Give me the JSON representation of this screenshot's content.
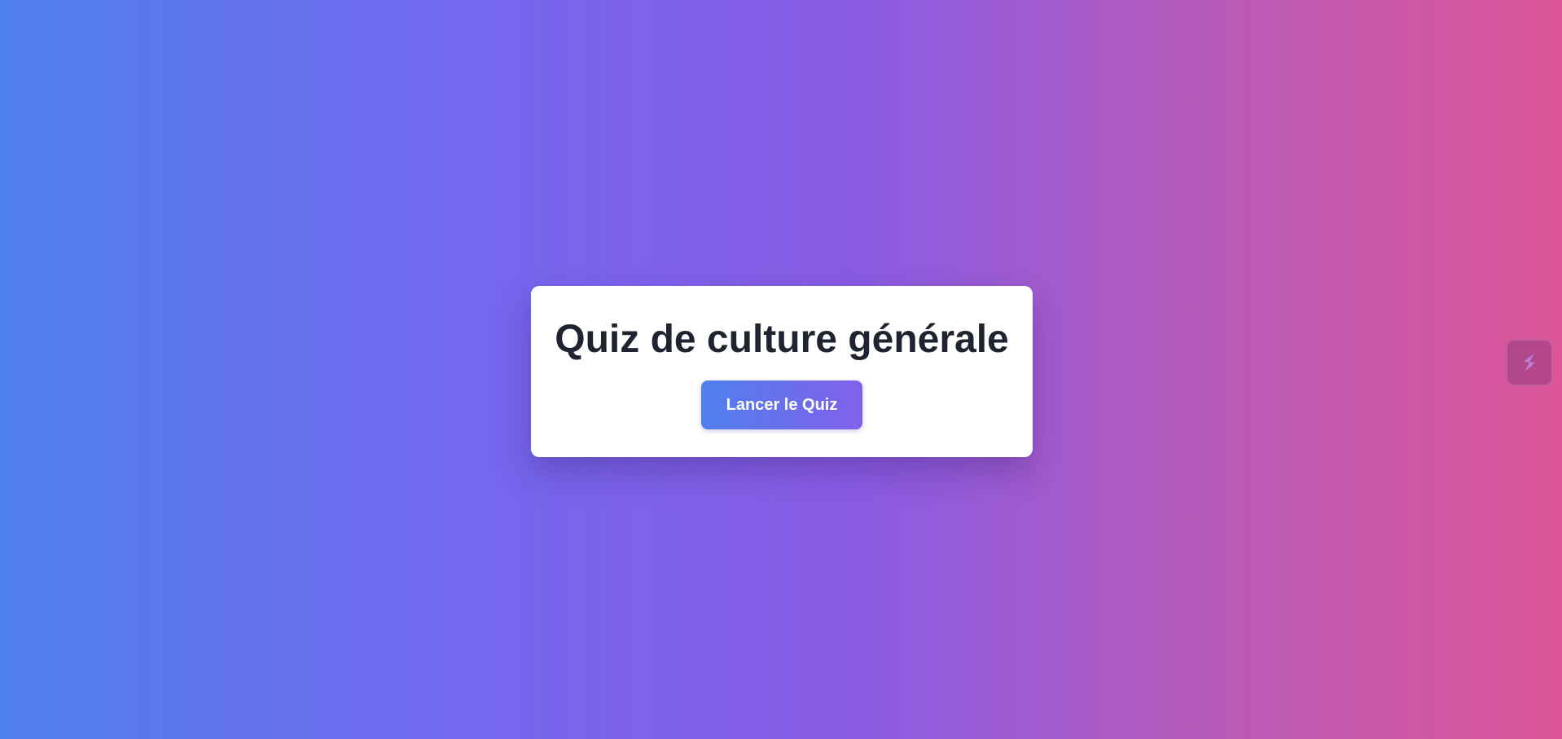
{
  "quiz": {
    "title": "Quiz de culture générale",
    "start_button_label": "Lancer le Quiz"
  },
  "side_widget": {
    "icon": "lightning-bolt-icon"
  },
  "colors": {
    "gradient_start": "#4f80ec",
    "gradient_mid": "#8a5be4",
    "gradient_end": "#dc5597",
    "title_text": "#1f2430",
    "button_text": "#ffffff"
  }
}
